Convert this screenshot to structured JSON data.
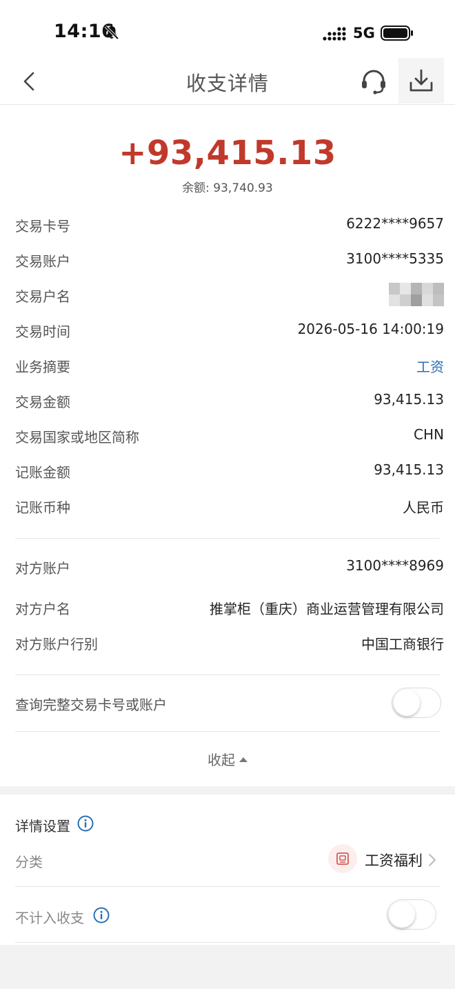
{
  "status_bar": {
    "time": "14:16",
    "network": "5G"
  },
  "nav": {
    "title": "收支详情"
  },
  "transaction": {
    "amount": "+93,415.13",
    "balance_label": "余额:",
    "balance_value": "93,740.93"
  },
  "details": [
    {
      "label": "交易卡号",
      "value": "6222****9657"
    },
    {
      "label": "交易账户",
      "value": "3100****5335"
    },
    {
      "label": "交易户名",
      "value": ""
    },
    {
      "label": "交易时间",
      "value": "2026-05-16 14:00:19"
    },
    {
      "label": "业务摘要",
      "value": "工资"
    },
    {
      "label": "交易金额",
      "value": "93,415.13"
    },
    {
      "label": "交易国家或地区简称",
      "value": "CHN"
    },
    {
      "label": "记账金额",
      "value": "93,415.13"
    },
    {
      "label": "记账币种",
      "value": "人民币"
    }
  ],
  "counterparty": [
    {
      "label": "对方账户",
      "value": "3100****8969"
    },
    {
      "label": "对方户名",
      "value": "推掌柜（重庆）商业运营管理有限公司"
    },
    {
      "label": "对方账户行别",
      "value": "中国工商银行"
    }
  ],
  "full_number_toggle": {
    "label": "查询完整交易卡号或账户",
    "on": false
  },
  "collapse_label": "收起",
  "settings": {
    "title": "详情设置",
    "category_label": "分类",
    "category_value": "工资福利",
    "exclude_label": "不计入收支",
    "exclude_on": false
  },
  "colors": {
    "amount": "#c0392b",
    "link": "#2a6fb5",
    "info_icon": "#2a6fb5"
  }
}
